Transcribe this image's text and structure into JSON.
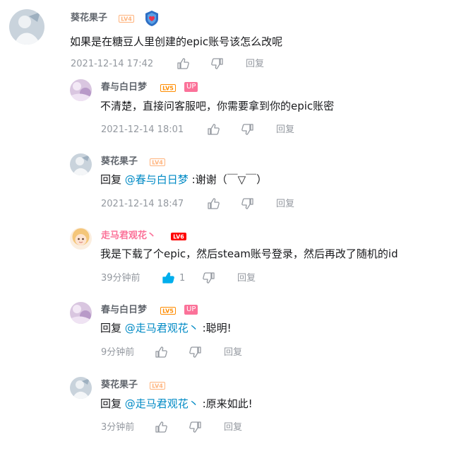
{
  "colors": {
    "pink": "#fb7299",
    "link": "#008ac5",
    "muted": "#9499a0",
    "liked": "#00aeec",
    "lv4": "#ffb37c",
    "lv5": "#ff8c00",
    "lv6": "#ff0000"
  },
  "comments": [
    {
      "user": "葵花果子",
      "level": "LV4",
      "has_medal": true,
      "text": "如果是在糖豆人里创建的epic账号该怎么改呢",
      "time": "2021-12-14 17:42",
      "reply_label": "回复"
    },
    {
      "user": "春与白日梦",
      "level": "LV5",
      "up_badge": "UP",
      "text": "不清楚，直接问客服吧，你需要拿到你的epic账密",
      "time": "2021-12-14 18:01",
      "reply_label": "回复"
    },
    {
      "user": "葵花果子",
      "level": "LV4",
      "prefix": "回复 ",
      "mention": "@春与白日梦",
      "text": " :谢谢（￣▽￣）",
      "time": "2021-12-14 18:47",
      "reply_label": "回复"
    },
    {
      "user": "走马君观花丶",
      "level": "LV6",
      "text": "我是下载了个epic，然后steam账号登录，然后再改了随机的id",
      "time": "39分钟前",
      "likes": "1",
      "reply_label": "回复"
    },
    {
      "user": "春与白日梦",
      "level": "LV5",
      "up_badge": "UP",
      "prefix": "回复 ",
      "mention": "@走马君观花丶",
      "text": " :聪明!",
      "time": "9分钟前",
      "reply_label": "回复"
    },
    {
      "user": "葵花果子",
      "level": "LV4",
      "prefix": "回复 ",
      "mention": "@走马君观花丶",
      "text": " :原来如此!",
      "time": "3分钟前",
      "reply_label": "回复"
    }
  ]
}
